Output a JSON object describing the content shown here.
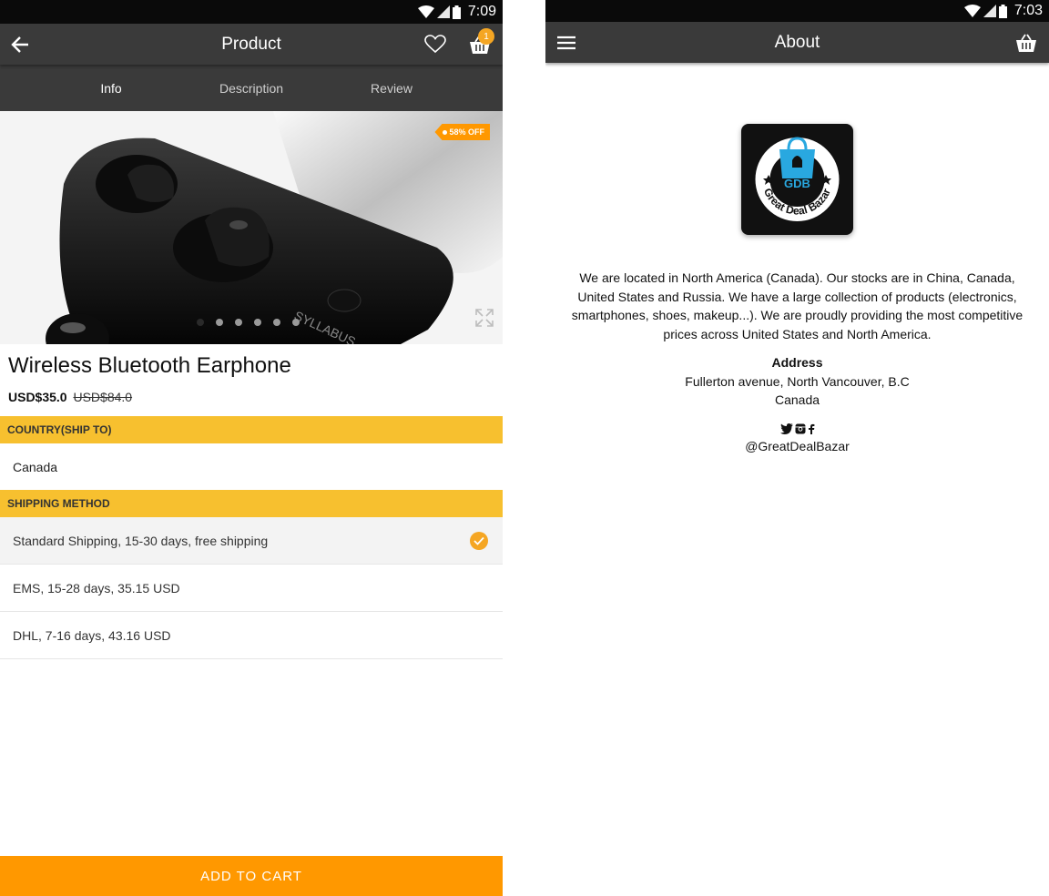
{
  "left": {
    "status": {
      "time": "7:09"
    },
    "appbar": {
      "title": "Product",
      "cart_count": "1"
    },
    "tabs": [
      "Info",
      "Description",
      "Review"
    ],
    "product": {
      "discount": "58% OFF",
      "image_brand": "SYLLABUS",
      "name": "Wireless Bluetooth Earphone",
      "price": "USD$35.0",
      "old_price": "USD$84.0"
    },
    "country": {
      "header": "COUNTRY(SHIP TO)",
      "value": "Canada"
    },
    "shipping": {
      "header": "SHIPPING METHOD",
      "options": [
        "Standard Shipping, 15-30 days, free shipping",
        "EMS, 15-28 days, 35.15 USD",
        "DHL, 7-16 days, 43.16 USD"
      ],
      "selected_index": 0
    },
    "cta": "ADD TO CART",
    "accent": "#ff9800",
    "section_color": "#f7c02f"
  },
  "right": {
    "status": {
      "time": "7:03"
    },
    "appbar": {
      "title": "About"
    },
    "logo": {
      "initials": "GDB",
      "text": "Great Deal Bazar"
    },
    "about_text": "We are located in North America (Canada). Our stocks are in China, Canada, United States and Russia. We have a large collection of products (electronics, smartphones, shoes, makeup...). We are proudly providing the most competitive prices across United States and North America.",
    "address": {
      "label": "Address",
      "line1": "Fullerton avenue, North Vancouver, B.C",
      "line2": "Canada"
    },
    "social": {
      "icons": [
        "twitter-icon",
        "instagram-icon",
        "facebook-icon"
      ],
      "handle": "@GreatDealBazar"
    }
  }
}
